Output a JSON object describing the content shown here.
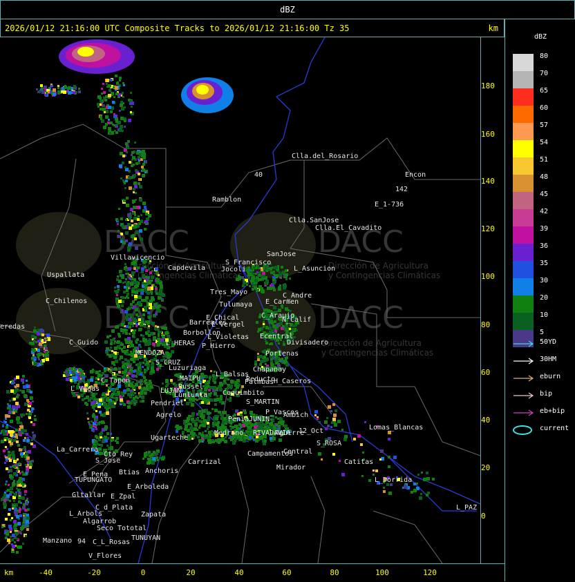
{
  "window": {
    "title": "dBZ"
  },
  "header": {
    "title": "2026/01/12 21:16:00 UTC Composite Tracks to 2026/01/12 21:16:00 Tz 35",
    "unit": "km"
  },
  "axes": {
    "x_unit": "km",
    "x_ticks": [
      "-40",
      "-20",
      "0",
      "20",
      "40",
      "60",
      "80",
      "100",
      "120"
    ],
    "y_ticks": [
      "180",
      "160",
      "140",
      "120",
      "100",
      "80",
      "60",
      "40",
      "20",
      "0"
    ]
  },
  "legend": {
    "title": "dBZ",
    "levels": [
      {
        "label": "80",
        "color": "#d8d8d8"
      },
      {
        "label": "70",
        "color": "#b4b4b4"
      },
      {
        "label": "65",
        "color": "#ff2c20"
      },
      {
        "label": "60",
        "color": "#ff6a00"
      },
      {
        "label": "57",
        "color": "#ff9a50"
      },
      {
        "label": "54",
        "color": "#ffff00"
      },
      {
        "label": "51",
        "color": "#f8c830"
      },
      {
        "label": "48",
        "color": "#d99030"
      },
      {
        "label": "45",
        "color": "#c06480"
      },
      {
        "label": "42",
        "color": "#c83c96"
      },
      {
        "label": "39",
        "color": "#c010a0"
      },
      {
        "label": "36",
        "color": "#6820d0"
      },
      {
        "label": "35",
        "color": "#2050e0"
      },
      {
        "label": "30",
        "color": "#1080e8"
      },
      {
        "label": "20",
        "color": "#108010"
      },
      {
        "label": "10",
        "color": "#0a6020"
      },
      {
        "label": "5",
        "color": "#4a3888"
      }
    ],
    "tracks": [
      {
        "label": "50YD",
        "color": "#40d8d8"
      },
      {
        "label": "30HM",
        "color": "#ffffff"
      },
      {
        "label": "eburn",
        "color": "#e0b070"
      },
      {
        "label": "bip",
        "color": "#f0c8c8"
      },
      {
        "label": "eb+bip",
        "color": "#d040c0"
      },
      {
        "label": "current",
        "color": "#40e0e0"
      }
    ]
  },
  "watermark": {
    "name": "DACC",
    "line1": "Dirección de Agricultura",
    "line2": "y Contingencias Climáticas"
  },
  "places": [
    "Clla.del_Rosario",
    "Encon",
    "142",
    "E_1-736",
    "Ramblon",
    "40",
    "Clla.SanJose",
    "Clla.El_Cavadito",
    "Villavicencio",
    "Capdevila",
    "S_Francisco",
    "SanJose",
    "L_Asuncion",
    "Uspallata",
    "Jocoli",
    "Tres_Mayo",
    "C_Andre",
    "E_Carmen",
    "Tulumaya",
    "C_Chilenos",
    "C_Araujo",
    "N_Calif",
    "E_Chical",
    "E_Vergel",
    "Barreales",
    "Borbollon",
    "Ecentral",
    "Divisadero",
    "C_Guido",
    "L_HERAS",
    "L_Violetas",
    "P_Hierro",
    "MENDOZA",
    "Portenas",
    "S_CRUZ",
    "Chapanay",
    "Luzuriaga",
    "L_Balsas",
    "Reducto",
    "Palmbas",
    "H_Caseros",
    "C_Tapon",
    "MAIPU",
    "Russel",
    "LUJAN",
    "Lunlunta",
    "L_Vegas",
    "Pendriel",
    "Coquimbito",
    "S_MARTIN",
    "Agrelo",
    "P_Vascos",
    "Ambich",
    "PeniaJUNIN",
    "RIVADAVIA",
    "Aguirre",
    "Medrano",
    "12_Oct",
    "Ugarteche",
    "S_ROSA",
    "Lomas_Blancas",
    "Carrizal",
    "Campamentos",
    "Central",
    "La_Carrera",
    "Cto_Rey",
    "S_Jose",
    "Catitas",
    "Anchoris",
    "Mirador",
    "E_Pena",
    "Btias",
    "TUPUNGATO",
    "L_Dorrida",
    "E_Arboleda",
    "Gltallar",
    "E_Zpal",
    "C_d_Plata",
    "Zapata",
    "L_Arbols",
    "L_PAZ",
    "Algarrob",
    "Seco",
    "Tototal",
    "Manzano",
    "C_L_Rosas",
    "TUNUYAN",
    "V_Flores",
    "94",
    "eredas"
  ]
}
